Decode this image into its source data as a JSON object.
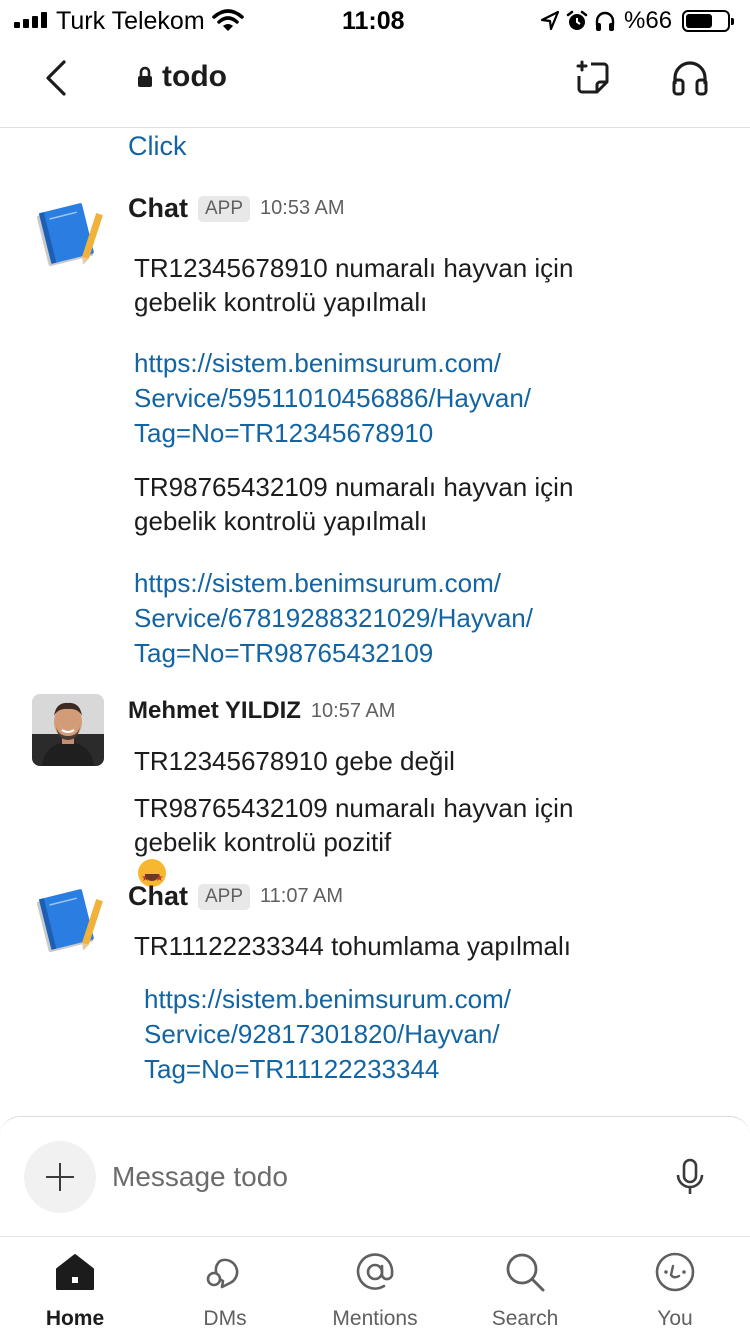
{
  "status_bar": {
    "carrier": "Turk Telekom",
    "time": "11:08",
    "battery_pct": "%66",
    "battery_level": 0.66,
    "icons": [
      "signal-icon",
      "wifi-icon",
      "location-arrow-icon",
      "alarm-icon",
      "headphones-icon",
      "battery-icon"
    ]
  },
  "header": {
    "channel_name": "todo",
    "icons": [
      "back-chevron-icon",
      "lock-icon",
      "new-canvas-icon",
      "huddle-headphones-icon"
    ]
  },
  "messages": {
    "previous_link": "Click",
    "items": [
      {
        "sender": "Chat",
        "badge": "APP",
        "time": "10:53 AM",
        "lines": {
          "text1": [
            "TR12345678910 numaralı hayvan için",
            "gebelik kontrolü yapılmalı"
          ],
          "link1": [
            "https://sistem.benimsurum.com/",
            "Service/59511010456886/Hayvan/",
            "Tag=No=TR12345678910"
          ],
          "text2": [
            "TR98765432109 numaralı hayvan için",
            "gebelik kontrolü yapılmalı"
          ],
          "link2": [
            "https://sistem.benimsurum.com/",
            "Service/67819288321029/Hayvan/",
            "Tag=No=TR98765432109"
          ]
        }
      },
      {
        "sender": "Mehmet YILDIZ",
        "time": "10:57 AM",
        "lines": {
          "text1": [
            "TR12345678910 gebe değil"
          ],
          "text2": [
            "TR98765432109 numaralı hayvan için",
            "gebelik kontrolü pozitif"
          ]
        },
        "emoji": "star-struck-emoji"
      },
      {
        "sender": "Chat",
        "badge": "APP",
        "time": "11:07 AM",
        "lines": {
          "text1": [
            "TR11122233344 tohumlama yapılmalı"
          ],
          "link1": [
            "https://sistem.benimsurum.com/",
            "Service/92817301820/Hayvan/",
            "Tag=No=TR11122233344"
          ]
        }
      }
    ]
  },
  "composer": {
    "placeholder": "Message todo",
    "icons": [
      "plus-icon",
      "microphone-icon"
    ]
  },
  "tabs": [
    {
      "label": "Home",
      "icon": "home-icon",
      "active": true
    },
    {
      "label": "DMs",
      "icon": "dms-icon",
      "active": false
    },
    {
      "label": "Mentions",
      "icon": "at-sign-icon",
      "active": false
    },
    {
      "label": "Search",
      "icon": "search-icon",
      "active": false
    },
    {
      "label": "You",
      "icon": "you-face-icon",
      "active": false
    }
  ],
  "colors": {
    "link": "#1264a3",
    "text": "#1d1c1d",
    "muted": "#616061",
    "badge_bg": "#e8e8e8"
  }
}
